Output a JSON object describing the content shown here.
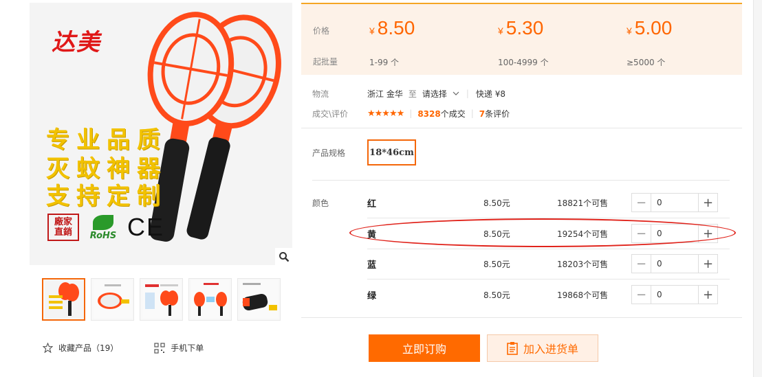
{
  "gallery": {
    "brand_logo": "达美",
    "slogans": [
      "专业品质",
      "灭蚊神器",
      "支持定制"
    ],
    "cert_factory": "廠家直銷",
    "cert_rohs": "RoHS",
    "cert_ce": "CE",
    "zoom_icon": "magnifier-icon"
  },
  "left_actions": {
    "favorite_label": "收藏产品（19）",
    "mobile_label": "手机下单"
  },
  "price": {
    "label_price": "价格",
    "label_moq": "起批量",
    "currency": "¥",
    "tiers": [
      {
        "price": "8.50",
        "qty": "1-99 个"
      },
      {
        "price": "5.30",
        "qty": "100-4999 个"
      },
      {
        "price": "5.00",
        "qty": "≥5000 个"
      }
    ]
  },
  "logistics": {
    "label": "物流",
    "origin": "浙江 金华",
    "to": "至",
    "dest_select": "请选择",
    "express": "快递 ¥8"
  },
  "deals": {
    "label": "成交\\评价",
    "stars": "★★★★★",
    "deal_count": "8328",
    "deal_suffix": "个成交",
    "review_count": "7",
    "review_suffix": "条评价"
  },
  "spec": {
    "label": "产品规格",
    "option": "18*46cm"
  },
  "colors": {
    "label": "颜色",
    "rows": [
      {
        "name": "红",
        "price": "8.50元",
        "stock": "18821个可售",
        "qty": "0"
      },
      {
        "name": "黄",
        "price": "8.50元",
        "stock": "19254个可售",
        "qty": "0"
      },
      {
        "name": "蓝",
        "price": "8.50元",
        "stock": "18203个可售",
        "qty": "0"
      },
      {
        "name": "绿",
        "price": "8.50元",
        "stock": "19868个可售",
        "qty": "0"
      }
    ]
  },
  "actions": {
    "buy_now": "立即订购",
    "add_to_list": "加入进货单"
  },
  "theme": {
    "accent": "#ff6a00",
    "price_bg": "#fdf2e8",
    "highlight": "#e0221a"
  }
}
